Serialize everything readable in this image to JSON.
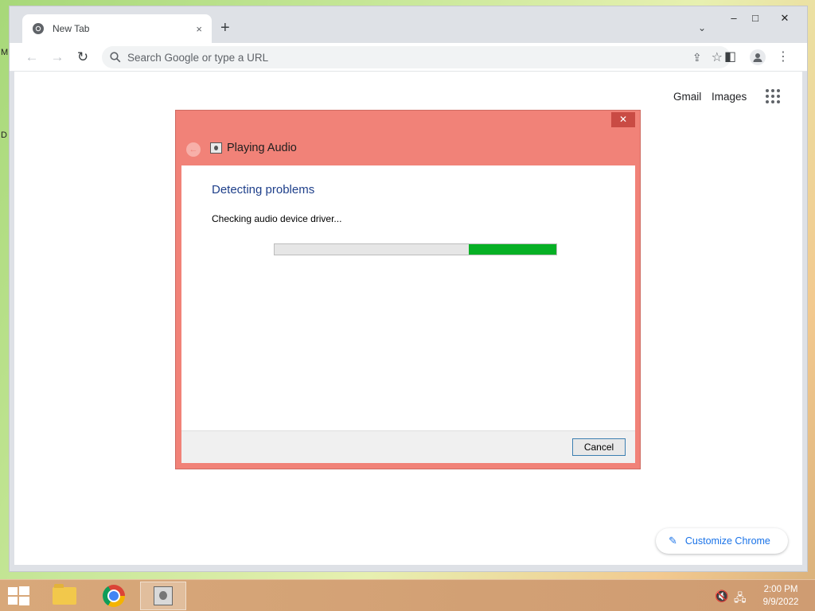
{
  "desktop": {
    "glyph_m": "M",
    "glyph_d": "D"
  },
  "browser": {
    "tab_title": "New Tab",
    "tab_close": "×",
    "new_tab": "+",
    "tab_search": "⌄",
    "window_controls": {
      "minimize": "–",
      "maximize": "□",
      "close": "✕"
    },
    "nav": {
      "back": "←",
      "forward": "→",
      "reload": "↻"
    },
    "omnibox_placeholder": "Search Google or type a URL",
    "toolbar_icons": {
      "share": "⇪",
      "bookmark": "☆",
      "side_panel": "◧",
      "menu": "⋮"
    },
    "top_links": {
      "gmail": "Gmail",
      "images": "Images"
    },
    "customize_label": "Customize Chrome",
    "customize_icon": "✎"
  },
  "dialog": {
    "title": "Playing Audio",
    "heading": "Detecting problems",
    "status": "Checking audio device driver...",
    "progress": {
      "fill_start_fraction": 0.69,
      "fill_end_fraction": 1.0,
      "fill_color": "#06b025"
    },
    "cancel_label": "Cancel",
    "close_glyph": "✕",
    "back_glyph": "←",
    "accent_color": "#f18278"
  },
  "taskbar": {
    "items": [
      "file-explorer",
      "google-chrome",
      "troubleshooter"
    ],
    "tray": {
      "volume": "🔇",
      "network": "🖧"
    },
    "clock_time": "2:00 PM",
    "clock_date": "9/9/2022"
  }
}
